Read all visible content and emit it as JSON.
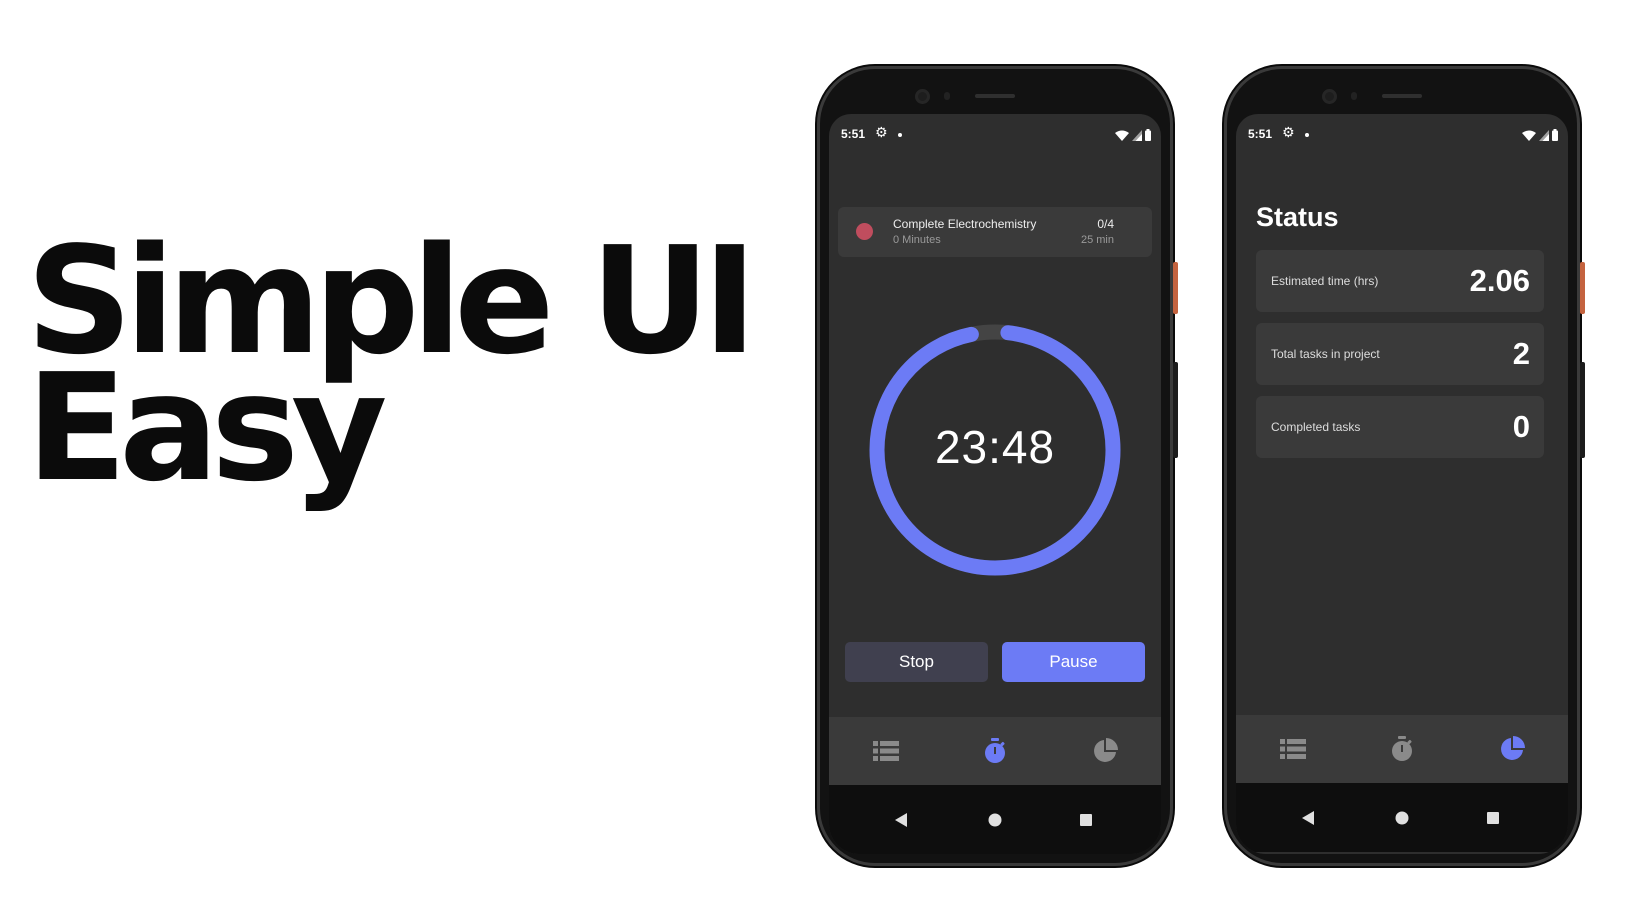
{
  "headline": {
    "line1": "Simple UI",
    "line2": "Easy"
  },
  "colors": {
    "accent": "#6c7bf5",
    "nav_inactive": "#8a8a8a",
    "task_dot": "#c04d5e",
    "surface": "#2e2e2e",
    "card": "#3a3a3a"
  },
  "timer_screen": {
    "statusbar": {
      "time": "5:51"
    },
    "task": {
      "title": "Complete  Electrochemistry",
      "subtitle": "0 Minutes",
      "count": "0/4",
      "duration": "25 min"
    },
    "timer": {
      "display": "23:48",
      "progress": 0.95
    },
    "buttons": {
      "stop": "Stop",
      "pause": "Pause"
    },
    "nav": [
      {
        "icon": "list-icon",
        "active": false
      },
      {
        "icon": "stopwatch-icon",
        "active": true
      },
      {
        "icon": "pie-chart-icon",
        "active": false
      }
    ]
  },
  "status_screen": {
    "statusbar": {
      "time": "5:51"
    },
    "title": "Status",
    "stats": [
      {
        "label": "Estimated time (hrs)",
        "value": "2.06"
      },
      {
        "label": "Total tasks in project",
        "value": "2"
      },
      {
        "label": "Completed tasks",
        "value": "0"
      }
    ],
    "nav": [
      {
        "icon": "list-icon",
        "active": false
      },
      {
        "icon": "stopwatch-icon",
        "active": false
      },
      {
        "icon": "pie-chart-icon",
        "active": true
      }
    ]
  }
}
